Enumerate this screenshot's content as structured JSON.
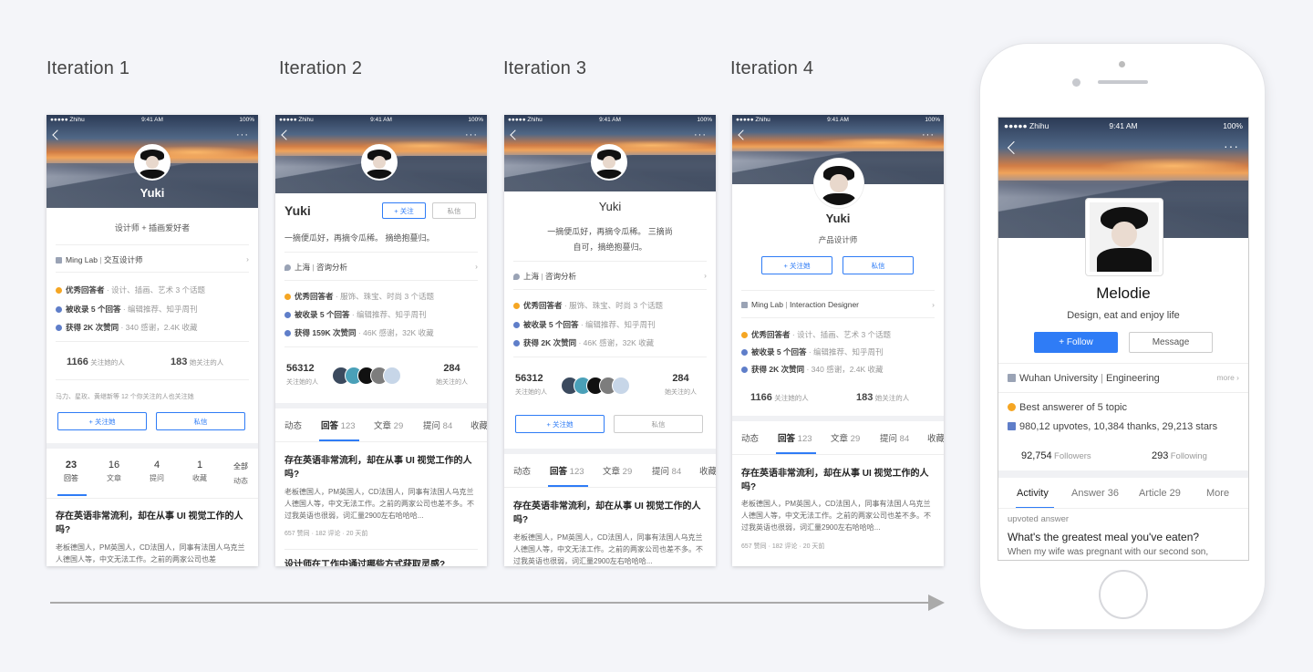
{
  "iterations": [
    {
      "title": "Iteration 1"
    },
    {
      "title": "Iteration 2"
    },
    {
      "title": "Iteration 3"
    },
    {
      "title": "Iteration 4"
    }
  ],
  "status": {
    "carrier": "●●●●● Zhihu",
    "time": "9:41 AM",
    "battery": "100%"
  },
  "s1": {
    "name": "Yuki",
    "bio": "设计师 + 插画爱好者",
    "company": "Ming Lab",
    "job": "交互设计师",
    "badge1_strong": "优秀回答者",
    "badge1_rest": "· 设计、插画、艺术 3 个话题",
    "badge2_strong": "被收录 5 个回答",
    "badge2_rest": "· 编辑推荐、知乎周刊",
    "badge3_strong": "获得 2K 次赞同",
    "badge3_rest": "· 340 感谢，2.4K 收藏",
    "followers_num": "1166",
    "followers_label": "关注她的人",
    "following_num": "183",
    "following_label": "她关注的人",
    "mutual": "马力、星玫、黄继新等 12 个你关注的人也关注她",
    "follow_btn": "+ 关注她",
    "msg_btn": "私信",
    "stats": [
      {
        "num": "23",
        "label": "回答"
      },
      {
        "num": "16",
        "label": "文章"
      },
      {
        "num": "4",
        "label": "提问"
      },
      {
        "num": "1",
        "label": "收藏"
      },
      {
        "num": "全部",
        "label": "动态"
      }
    ],
    "q_title": "存在英语非常流利，却在从事 UI 视觉工作的人吗?",
    "q_desc": "老板德国人，PM英国人，CD法国人，同事有法国人乌克兰人德国人等，中文无法工作。之前的两家公司也差"
  },
  "s2": {
    "name": "Yuki",
    "follow_btn": "+ 关注",
    "msg_btn": "私信",
    "bio": "一摘便瓜好，再摘令瓜稀。 摘绝抱蔓归。",
    "location": "上海",
    "industry": "咨询分析",
    "badge1_strong": "优秀回答者",
    "badge1_rest": "· 服饰、珠宝、时尚 3 个话题",
    "badge2_strong": "被收录 5 个回答",
    "badge2_rest": "· 编辑推荐、知乎周刊",
    "badge3_strong": "获得 159K 次赞同",
    "badge3_rest": "· 46K 感谢，32K 收藏",
    "followers_num": "56312",
    "followers_label": "关注她的人",
    "following_num": "284",
    "following_label": "她关注的人",
    "tabs": [
      "动态",
      "回答",
      "文章",
      "提问",
      "收藏"
    ],
    "tab_counts": [
      "",
      "123",
      "29",
      "84",
      ""
    ],
    "q_title": "存在英语非常流利，却在从事 UI 视觉工作的人吗?",
    "q_desc": "老板德国人，PM英国人，CD法国人，同事有法国人乌克兰人德国人等，中文无法工作。之前的两家公司也差不多。不过我英语也很弱，词汇量2900左右哈哈哈...",
    "q_meta": "657 赞同 · 182 评论 · 20 天前",
    "q2_title": "设计师在工作中通过哪些方式获取灵感?"
  },
  "s3": {
    "name": "Yuki",
    "bio1": "一摘便瓜好，再摘令瓜稀。 三摘尚",
    "bio2": "自可，摘绝抱蔓归。",
    "location": "上海",
    "industry": "咨询分析",
    "badge1_strong": "优秀回答者",
    "badge1_rest": "· 服饰、珠宝、时尚 3 个话题",
    "badge2_strong": "被收录 5 个回答",
    "badge2_rest": "· 编辑推荐、知乎周刊",
    "badge3_strong": "获得 2K 次赞同",
    "badge3_rest": "· 46K 感谢，32K 收藏",
    "followers_num": "56312",
    "followers_label": "关注她的人",
    "following_num": "284",
    "following_label": "她关注的人",
    "follow_btn": "+ 关注她",
    "msg_btn": "私信",
    "tabs": [
      "动态",
      "回答",
      "文章",
      "提问",
      "收藏"
    ],
    "tab_counts": [
      "",
      "123",
      "29",
      "84",
      ""
    ],
    "q_title": "存在英语非常流利，却在从事 UI 视觉工作的人吗?",
    "q_desc": "老板德国人，PM英国人，CD法国人，同事有法国人乌克兰人德国人等，中文无法工作。之前的两家公司也差不多。不过我英语也很弱，词汇量2900左右哈哈哈..."
  },
  "s4": {
    "name": "Yuki",
    "bio": "产品设计师",
    "follow_btn": "+ 关注她",
    "msg_btn": "私信",
    "company": "Ming Lab",
    "job": "Interaction Designer",
    "badge1_strong": "优秀回答者",
    "badge1_rest": "· 设计、插画、艺术 3 个话题",
    "badge2_strong": "被收录 5 个回答",
    "badge2_rest": "· 编辑推荐、知乎周刊",
    "badge3_strong": "获得 2K 次赞同",
    "badge3_rest": "· 340 感谢，2.4K 收藏",
    "followers_num": "1166",
    "followers_label": "关注她的人",
    "following_num": "183",
    "following_label": "她关注的人",
    "tabs": [
      "动态",
      "回答",
      "文章",
      "提问",
      "收藏"
    ],
    "tab_counts": [
      "",
      "123",
      "29",
      "84",
      ""
    ],
    "q_title": "存在英语非常流利，却在从事 UI 视觉工作的人吗?",
    "q_desc": "老板德国人，PM英国人，CD法国人，同事有法国人乌克兰人德国人等，中文无法工作。之前的两家公司也差不多。不过我英语也很弱，词汇量2900左右哈哈哈...",
    "q_meta": "657 赞同 · 182 评论 · 20 天前"
  },
  "final": {
    "name": "Melodie",
    "bio": "Design, eat and enjoy life",
    "follow_btn": "+ Follow",
    "msg_btn": "Message",
    "school": "Wuhan University",
    "major": "Engineering",
    "more": "more ›",
    "badge1": "Best answerer of 5 topic",
    "badge2": "980,12 upvotes, 10,384 thanks, 29,213 stars",
    "followers_num": "92,754",
    "followers_label": "Followers",
    "following_num": "293",
    "following_label": "Following",
    "tabs": [
      {
        "label": "Activity",
        "count": ""
      },
      {
        "label": "Answer",
        "count": "36"
      },
      {
        "label": "Article",
        "count": "29"
      },
      {
        "label": "More",
        "count": ""
      }
    ],
    "feed_type": "upvoted answer",
    "feed_title": "What's the greatest meal you've eaten?",
    "feed_desc": "When my wife was pregnant with our second son,"
  },
  "colors": {
    "accent": "#2f7cf6",
    "badge_orange": "#f5a623",
    "badge_blue": "#5f7ec9",
    "bg": "#f4f5f9"
  }
}
